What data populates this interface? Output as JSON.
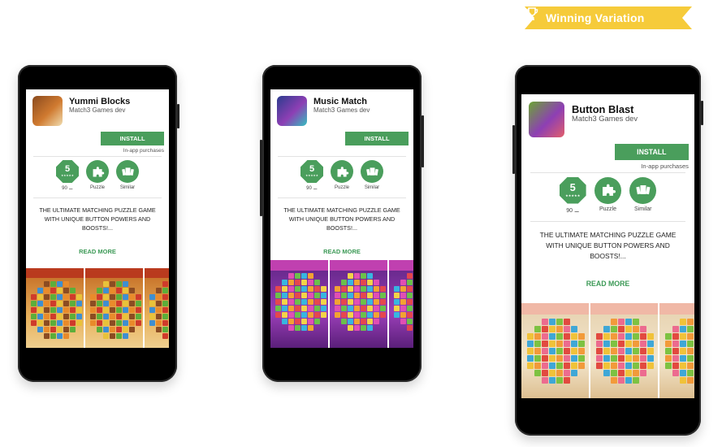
{
  "banner": {
    "label": "Winning Variation",
    "icon": "trophy-icon",
    "color": "#f6cb3a"
  },
  "colors": {
    "accent": "#4a9e5c",
    "phone": "#000000"
  },
  "variations": [
    {
      "app_title": "Yummi Blocks",
      "developer": "Match3 Games dev",
      "install_label": "INSTALL",
      "iap_label": "In-app purchases",
      "rating_value": "5",
      "rating_stars": "★★★★★",
      "rating_count": "90 ⚊",
      "badge_genre": "Puzzle",
      "badge_similar": "Similar",
      "description": "THE ULTIMATE MATCHING PUZZLE GAME WITH UNIQUE BUTTON POWERS AND BOOSTS!...",
      "read_more": "READ MORE",
      "theme": "yummi"
    },
    {
      "app_title": "Music Match",
      "developer": "Match3 Games dev",
      "install_label": "INSTALL",
      "iap_label": "",
      "rating_value": "5",
      "rating_stars": "★★★★★",
      "rating_count": "90 ⚊",
      "badge_genre": "Puzzle",
      "badge_similar": "Similar",
      "description": "THE ULTIMATE MATCHING PUZZLE GAME WITH UNIQUE BUTTON POWERS AND BOOSTS!...",
      "read_more": "READ MORE",
      "theme": "music"
    },
    {
      "app_title": "Button Blast",
      "developer": "Match3 Games dev",
      "install_label": "INSTALL",
      "iap_label": "In-app purchases",
      "rating_value": "5",
      "rating_stars": "★★★★★",
      "rating_count": "90 ⚊",
      "badge_genre": "Puzzle",
      "badge_similar": "Similar",
      "description": "THE ULTIMATE MATCHING PUZZLE GAME WITH UNIQUE BUTTON POWERS AND BOOSTS!...",
      "read_more": "READ MORE",
      "theme": "button"
    }
  ]
}
